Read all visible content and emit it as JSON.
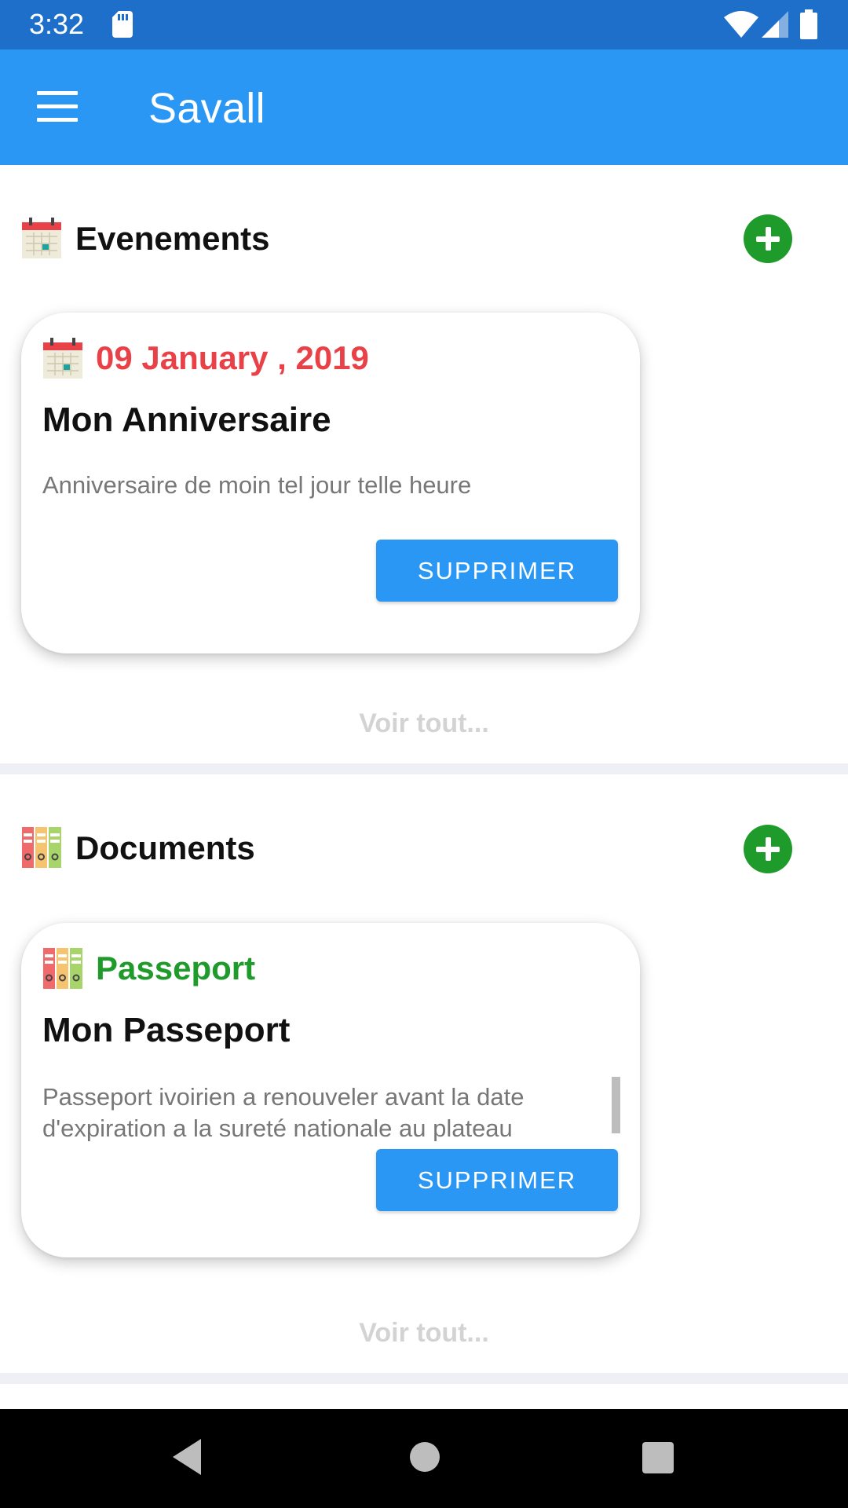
{
  "status_bar": {
    "time": "3:32",
    "icons": [
      "sd-card-icon",
      "wifi-icon",
      "signal-icon",
      "battery-icon"
    ]
  },
  "app_bar": {
    "title": "Savall",
    "menu_icon": "hamburger-menu-icon",
    "background_color": "#2B97F4"
  },
  "events": {
    "section_title": "Evenements",
    "section_icon": "calendar-icon",
    "add_icon": "add-circle-icon",
    "card": {
      "date": "09 January , 2019",
      "date_color": "#E84148",
      "title": "Mon Anniversaire",
      "description": "Anniversaire de moin tel jour telle heure",
      "delete_label": "SUPPRIMER"
    },
    "see_all": "Voir tout..."
  },
  "documents": {
    "section_title": "Documents",
    "section_icon": "binders-icon",
    "add_icon": "add-circle-icon",
    "card": {
      "category": "Passeport",
      "category_color": "#1E9B2A",
      "title": "Mon Passeport",
      "description": "Passeport ivoirien a renouveler avant la date d'expiration a la sureté nationale au plateau",
      "delete_label": "SUPPRIMER"
    },
    "see_all": "Voir tout..."
  },
  "nav_bar": {
    "icons": [
      "back-icon",
      "home-icon",
      "recent-apps-icon"
    ]
  }
}
